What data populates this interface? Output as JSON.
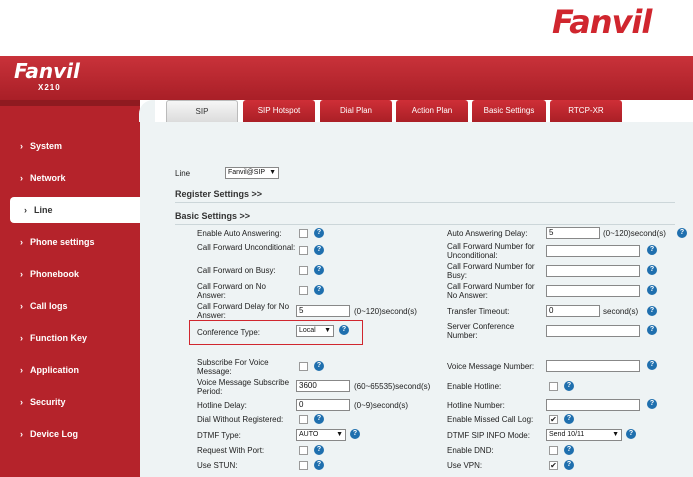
{
  "brand": {
    "logo_text": "Fanvil",
    "header_logo": "Fanvil",
    "model": "X210"
  },
  "sidebar": {
    "items": [
      {
        "label": "System"
      },
      {
        "label": "Network"
      },
      {
        "label": "Line"
      },
      {
        "label": "Phone settings"
      },
      {
        "label": "Phonebook"
      },
      {
        "label": "Call logs"
      },
      {
        "label": "Function Key"
      },
      {
        "label": "Application"
      },
      {
        "label": "Security"
      },
      {
        "label": "Device Log"
      }
    ],
    "active_index": 2
  },
  "tabs": [
    {
      "label": "SIP"
    },
    {
      "label": "SIP Hotspot"
    },
    {
      "label": "Dial Plan"
    },
    {
      "label": "Action Plan"
    },
    {
      "label": "Basic Settings"
    },
    {
      "label": "RTCP-XR"
    }
  ],
  "line": {
    "label": "Line",
    "value": "Fanvil@SIP"
  },
  "sections": {
    "register": "Register Settings >>",
    "basic": "Basic Settings >>"
  },
  "left": {
    "auto_answering": "Enable Auto Answering:",
    "cf_unconditional": "Call Forward Unconditional:",
    "cf_busy": "Call Forward on Busy:",
    "cf_no_answer": "Call Forward on No Answer:",
    "cf_delay": "Call Forward Delay for No Answer:",
    "cf_delay_value": "5",
    "cf_delay_unit": "(0~120)second(s)",
    "conference_type": "Conference Type:",
    "conference_value": "Local",
    "subscribe_vm": "Subscribe For Voice Message:",
    "vm_period": "Voice Message Subscribe Period:",
    "vm_period_value": "3600",
    "vm_period_unit": "(60~65535)second(s)",
    "hotline_delay": "Hotline Delay:",
    "hotline_delay_value": "0",
    "hotline_delay_unit": "(0~9)second(s)",
    "dial_without_reg": "Dial Without Registered:",
    "dtmf_type": "DTMF Type:",
    "dtmf_type_value": "AUTO",
    "request_with_port": "Request With Port:",
    "use_stun": "Use STUN:"
  },
  "right": {
    "auto_answer_delay": "Auto Answering Delay:",
    "auto_answer_delay_value": "5",
    "auto_answer_delay_unit": "(0~120)second(s)",
    "cf_num_uncond": "Call Forward Number for Unconditional:",
    "cf_num_busy": "Call Forward Number for Busy:",
    "cf_num_no_answer": "Call Forward Number for No Answer:",
    "transfer_timeout": "Transfer Timeout:",
    "transfer_timeout_value": "0",
    "transfer_timeout_unit": "second(s)",
    "server_conf_number": "Server Conference Number:",
    "vm_number": "Voice Message Number:",
    "enable_hotline": "Enable Hotline:",
    "hotline_number": "Hotline Number:",
    "missed_call_log": "Enable Missed Call Log:",
    "dtmf_sip_info": "DTMF SIP INFO Mode:",
    "dtmf_sip_info_value": "Send 10/11",
    "enable_dnd": "Enable DND:",
    "use_vpn": "Use VPN:"
  },
  "glyphs": {
    "help": "?",
    "check": "✔",
    "arrow": "▼",
    "chev": "›"
  }
}
